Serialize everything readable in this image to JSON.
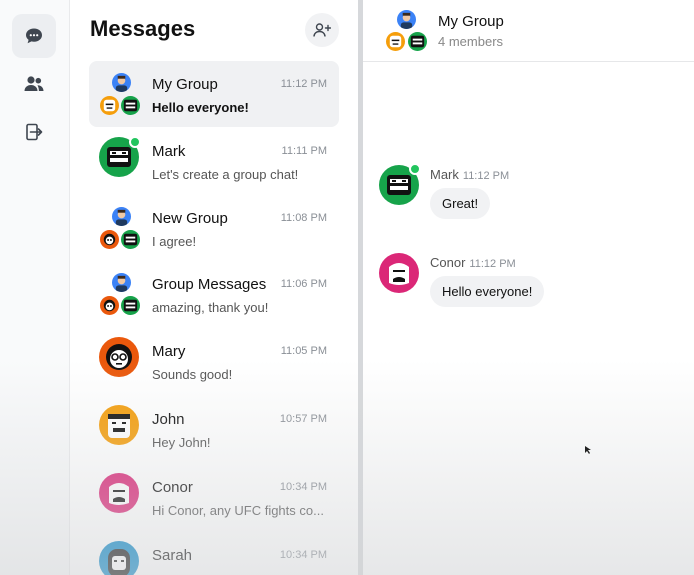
{
  "rail": {
    "items": [
      {
        "icon": "chat-bubble-icon",
        "active": true
      },
      {
        "icon": "users-icon",
        "active": false
      },
      {
        "icon": "logout-icon",
        "active": false
      }
    ]
  },
  "list": {
    "title": "Messages",
    "new_group_icon": "add-user-icon",
    "conversations": [
      {
        "name": "My Group",
        "preview": "Hello everyone!",
        "time": "11:12 PM",
        "group": true,
        "selected": true
      },
      {
        "name": "Mark",
        "preview": "Let's create a group chat!",
        "time": "11:11 PM",
        "group": false,
        "online": true
      },
      {
        "name": "New Group",
        "preview": "I agree!",
        "time": "11:08 PM",
        "group": true
      },
      {
        "name": "Group Messages",
        "preview": "amazing, thank you!",
        "time": "11:06 PM",
        "group": true
      },
      {
        "name": "Mary",
        "preview": "Sounds good!",
        "time": "11:05 PM",
        "group": false
      },
      {
        "name": "John",
        "preview": "Hey John!",
        "time": "10:57 PM",
        "group": false
      },
      {
        "name": "Conor",
        "preview": "Hi Conor, any UFC fights co...",
        "time": "10:34 PM",
        "group": false
      },
      {
        "name": "Sarah",
        "preview": "",
        "time": "10:34 PM",
        "group": false
      }
    ]
  },
  "chat": {
    "title": "My Group",
    "subtitle": "4 members",
    "messages": [
      {
        "sender": "Mark",
        "time": "11:12 PM",
        "text": "Great!",
        "online": true
      },
      {
        "sender": "Conor",
        "time": "11:12 PM",
        "text": "Hello everyone!",
        "online": false
      }
    ]
  },
  "colors": {
    "online": "#22c55e",
    "selected_bg": "#f0f1f3",
    "bubble_bg": "#f1f2f4",
    "mark_avatar": "#16a34a",
    "conor_avatar": "#db2777",
    "mary_avatar": "#ea580c",
    "john_avatar": "#f59e0b",
    "sarah_avatar": "#0284c7"
  }
}
